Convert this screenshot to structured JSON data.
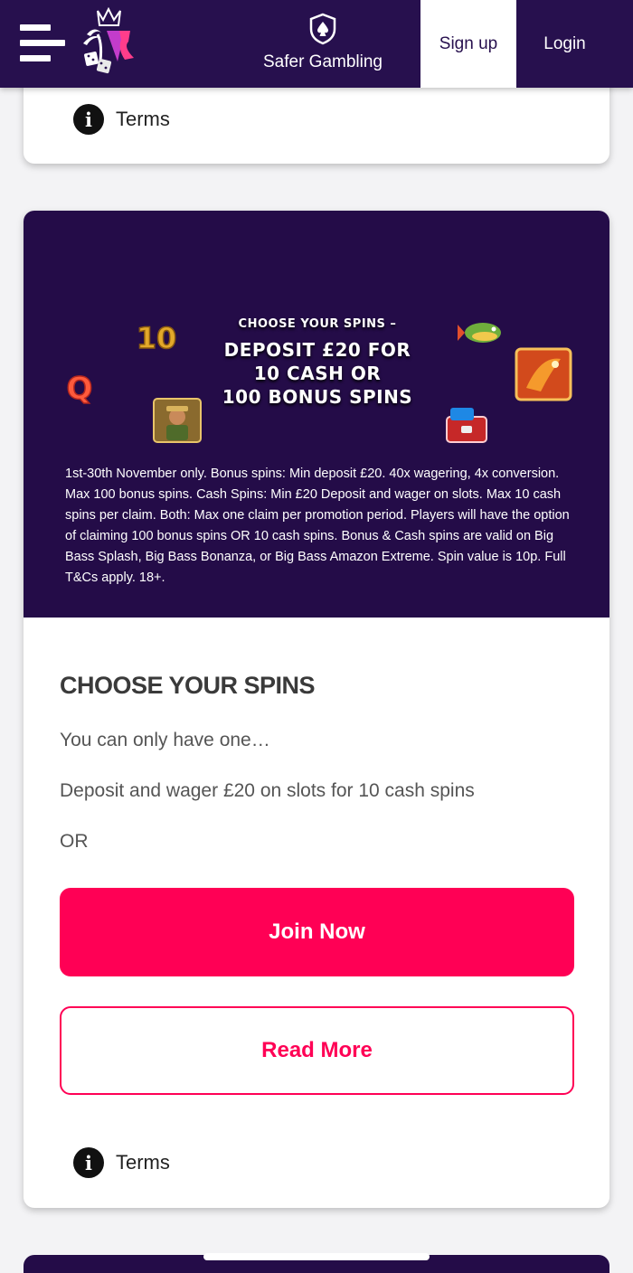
{
  "header": {
    "menu_icon": "hamburger-menu-icon",
    "logo_icon": "casino-logo-icon",
    "safer_icon": "spade-shield-icon",
    "safer_label": "Safer Gambling",
    "signup_label": "Sign up",
    "login_label": "Login",
    "bg_color": "#27104e"
  },
  "top_card": {
    "terms_label": "Terms",
    "info_glyph": "i"
  },
  "promo": {
    "banner": {
      "line_small": "CHOOSE YOUR SPINS –",
      "line_1": "DEPOSIT £20 FOR",
      "line_2": "10 CASH OR",
      "line_3": "100 BONUS SPINS",
      "symbol_ten": "10",
      "symbol_q": "Q",
      "bg_color": "#240c48"
    },
    "fine_print": "1st-30th November only. Bonus spins: Min deposit £20. 40x wagering, 4x conversion. Max 100 bonus spins. Cash Spins: Min £20 Deposit and wager on slots. Max 10 cash spins per claim. Both: Max one claim per promotion period. Players will have the option of claiming 100 bonus spins OR 10 cash spins. Bonus & Cash spins are valid on Big Bass Splash, Big Bass Bonanza, or Big Bass Amazon Extreme. Spin value is 10p. Full T&Cs apply. 18+.",
    "title": "CHOOSE YOUR SPINS",
    "line_1": "You can only have one…",
    "line_2": "Deposit and wager £20 on slots for 10 cash spins",
    "line_3": "OR",
    "join_label": "Join Now",
    "read_label": "Read More",
    "terms_label": "Terms",
    "info_glyph": "i",
    "accent_color": "#ff0055"
  }
}
